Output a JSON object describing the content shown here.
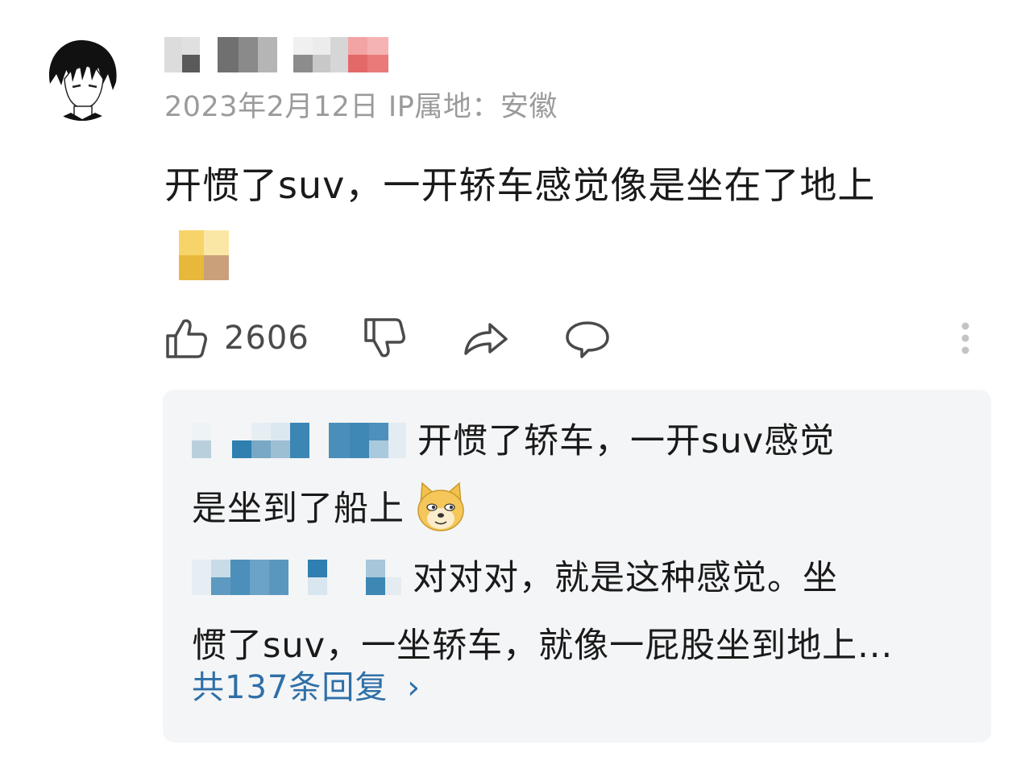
{
  "comment": {
    "username_display": "",
    "date": "2023年2月12日",
    "ip_label": "IP属地：安徽",
    "text": "开惯了suv，一开轿车感觉像是坐在了地上",
    "like_count": "2606",
    "icons": {
      "like": "thumb-up-icon",
      "dislike": "thumb-down-icon",
      "share": "share-arrow-icon",
      "reply": "comment-bubble-icon",
      "more": "more-vertical-icon"
    }
  },
  "replies": [
    {
      "line1": "开惯了轿车，一开suv感觉",
      "line2": "是坐到了船上"
    },
    {
      "line1": "对对对，就是这种感觉。坐",
      "line2": "惯了suv，一坐轿车，就像一屁股坐到地上..."
    }
  ],
  "more_replies": {
    "label": "共137条回复",
    "chevron": "›"
  },
  "colors": {
    "meta_text": "#9b9b9b",
    "link_blue": "#2e6fa7",
    "reply_bg": "#f4f5f7",
    "icon_gray": "#4a4a4a"
  }
}
